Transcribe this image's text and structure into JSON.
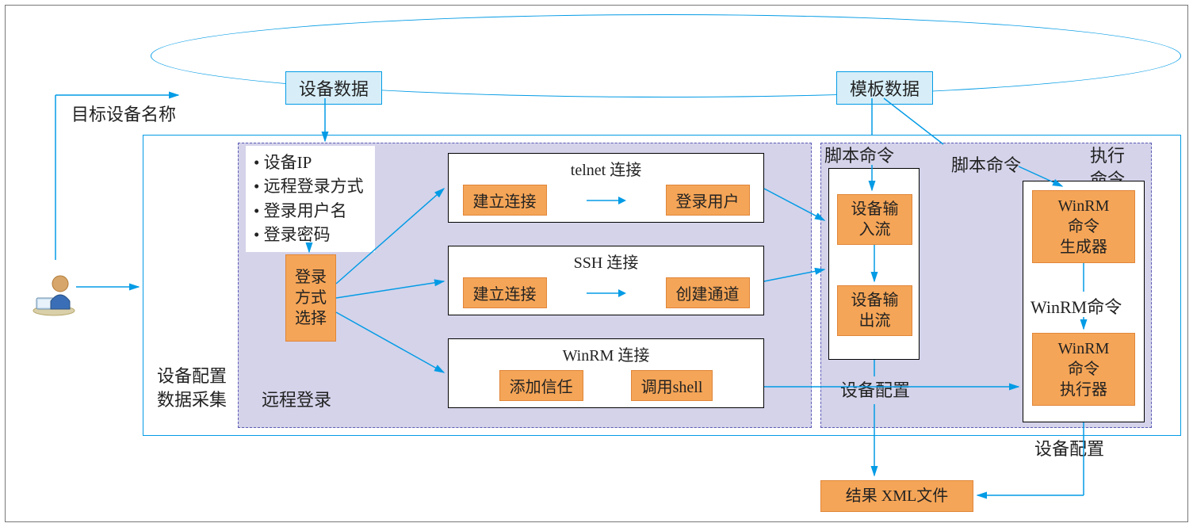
{
  "labels": {
    "target_device_name": "目标设备名称",
    "device_data": "设备数据",
    "template_data": "模板数据",
    "device_config_collection_l1": "设备配置",
    "device_config_collection_l2": "数据采集",
    "remote_login": "远程登录",
    "script_command": "脚本命令",
    "execute_command_l1": "执行",
    "execute_command_l2": "命令",
    "winrm_command": "WinRM命令",
    "device_config": "设备配置",
    "device_config2": "设备配置"
  },
  "attrs": {
    "a1": "设备IP",
    "a2": "远程登录方式",
    "a3": "登录用户名",
    "a4": "登录密码"
  },
  "login_select_l1": "登录",
  "login_select_l2": "方式",
  "login_select_l3": "选择",
  "groups": {
    "telnet": {
      "title": "telnet 连接",
      "b1": "建立连接",
      "b2": "登录用户"
    },
    "ssh": {
      "title": "SSH 连接",
      "b1": "建立连接",
      "b2": "创建通道"
    },
    "winrm": {
      "title": "WinRM 连接",
      "b1": "添加信任",
      "b2": "调用shell"
    }
  },
  "io": {
    "in_l1": "设备输",
    "in_l2": "入流",
    "out_l1": "设备输",
    "out_l2": "出流"
  },
  "winrm": {
    "gen_l1": "WinRM",
    "gen_l2": "命令",
    "gen_l3": "生成器",
    "exec_l1": "WinRM",
    "exec_l2": "命令",
    "exec_l3": "执行器"
  },
  "result_xml": "结果 XML文件"
}
